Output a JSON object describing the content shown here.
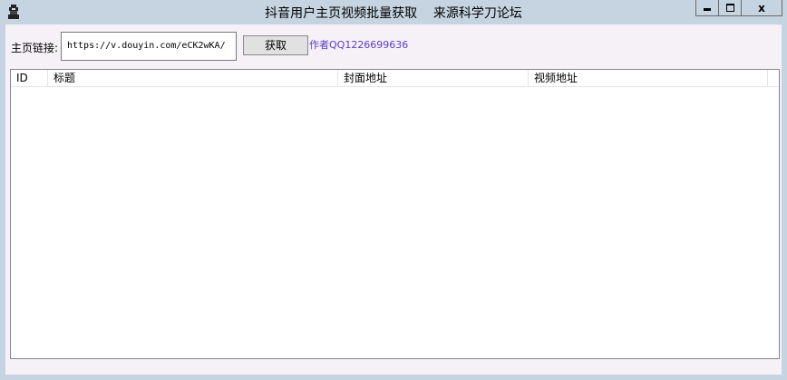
{
  "window": {
    "title": "抖音用户主页视频批量获取    来源科学刀论坛",
    "icon": "app-icon"
  },
  "controls": {
    "minimize_icon": "minimize-icon",
    "maximize_icon": "maximize-icon",
    "close_label": "x"
  },
  "form": {
    "url_label": "主页链接:",
    "url_value": "https://v.douyin.com/eCK2wKA/",
    "fetch_label": "获取",
    "author_text": "作者QQ1226699636"
  },
  "table": {
    "columns": [
      "ID",
      "标题",
      "封面地址",
      "视频地址"
    ],
    "rows": []
  }
}
